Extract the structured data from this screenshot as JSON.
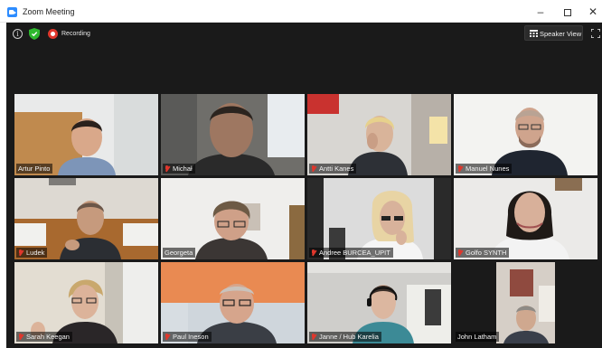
{
  "window": {
    "title": "Zoom Meeting",
    "minimize_glyph": "–",
    "close_glyph": "✕",
    "icon": "zoom-camera-icon"
  },
  "toolbar": {
    "info_glyph": "i",
    "recording_label": "Recording",
    "view_button_label": "Speaker View",
    "security_color": "#2eb82e",
    "recording_color": "#e0372c"
  },
  "accent": {
    "active_speaker_border": "#c4e64a"
  },
  "participants": [
    {
      "name": "Artur Pinto",
      "muted": false
    },
    {
      "name": "Michał",
      "muted": true
    },
    {
      "name": "Antti Kanes",
      "muted": true
    },
    {
      "name": "Manuel Nunes",
      "muted": true
    },
    {
      "name": "Ludek",
      "muted": true
    },
    {
      "name": "Georgeta",
      "muted": false,
      "active": true
    },
    {
      "name": "Andree BURCEA_UPIT",
      "muted": true
    },
    {
      "name": "Golfo SYNTH",
      "muted": true
    },
    {
      "name": "Sarah Keegan",
      "muted": true
    },
    {
      "name": "Paul Ineson",
      "muted": true
    },
    {
      "name": "Janne / Hub Karelia",
      "muted": true
    },
    {
      "name": "John Latham",
      "muted": false
    }
  ]
}
